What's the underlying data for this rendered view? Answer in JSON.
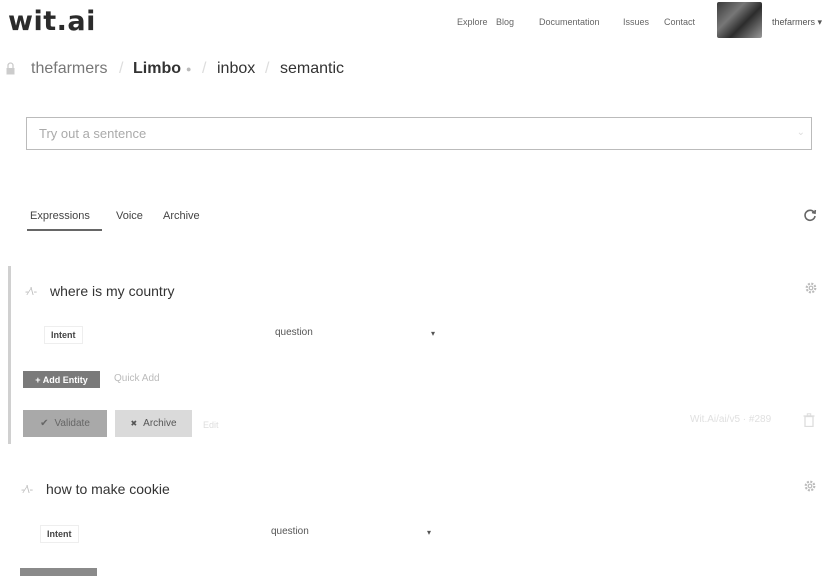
{
  "header": {
    "logo": "wit.ai",
    "nav": [
      "Explore",
      "Blog",
      "Documentation",
      "Issues",
      "Contact"
    ],
    "user": "thefarmers ▾"
  },
  "breadcrumb": {
    "org": "thefarmers",
    "app": "Limbo",
    "app_dot": "●",
    "inbox": "inbox",
    "view": "semantic",
    "separator": "/"
  },
  "search": {
    "placeholder": "Try out a sentence",
    "value": ""
  },
  "tabs": {
    "expressions": "Expressions",
    "voice": "Voice",
    "archive": "Archive"
  },
  "expressions": [
    {
      "spark": "-⁄\\-",
      "text": "where is my country",
      "entity_label": "Intent",
      "entity_value": "question",
      "caret": "▾",
      "add_entity": "+ Add Entity",
      "quick_add": "Quick Add",
      "validate": "Validate",
      "validate_icon": "✔",
      "archive": "Archive",
      "archive_icon": "✖",
      "extra_link": "Edit",
      "meta": "Wit.Ai/ai/v5 · #289"
    },
    {
      "spark": "-⁄\\-",
      "text": "how to make cookie",
      "entity_label": "Intent",
      "entity_value": "question",
      "caret": "▾"
    }
  ],
  "colors": {
    "accent_gray": "#7a7a7a",
    "validate_bg": "#a9a9a9",
    "archive_bg": "#dadada"
  }
}
